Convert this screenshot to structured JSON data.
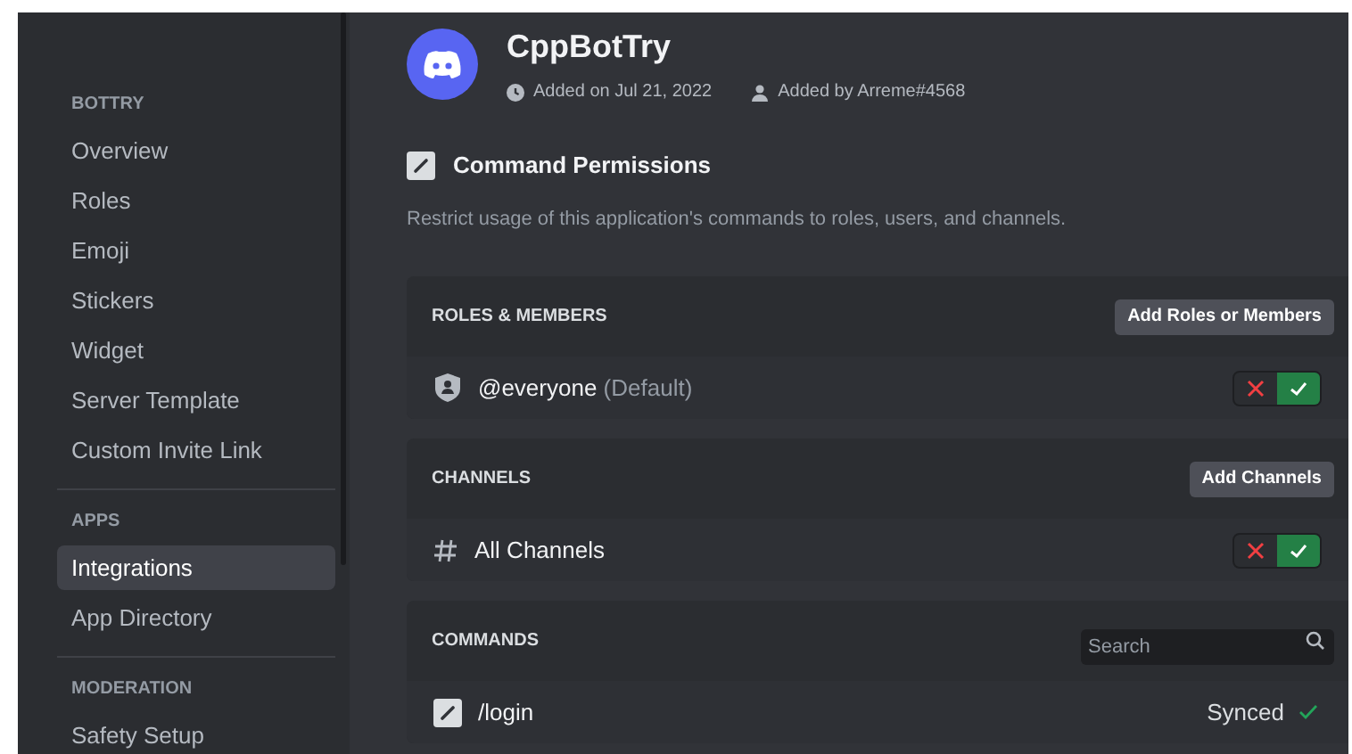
{
  "sidebar": {
    "sections": [
      {
        "header": "BOTTRY",
        "items": [
          {
            "label": "Overview",
            "selected": false
          },
          {
            "label": "Roles",
            "selected": false
          },
          {
            "label": "Emoji",
            "selected": false
          },
          {
            "label": "Stickers",
            "selected": false
          },
          {
            "label": "Widget",
            "selected": false
          },
          {
            "label": "Server Template",
            "selected": false
          },
          {
            "label": "Custom Invite Link",
            "selected": false
          }
        ]
      },
      {
        "header": "APPS",
        "items": [
          {
            "label": "Integrations",
            "selected": true
          },
          {
            "label": "App Directory",
            "selected": false
          }
        ]
      },
      {
        "header": "MODERATION",
        "items": [
          {
            "label": "Safety Setup",
            "selected": false
          }
        ]
      }
    ]
  },
  "app": {
    "name": "CppBotTry",
    "added_on": "Added on Jul 21, 2022",
    "added_by": "Added by Arreme#4568"
  },
  "permissions": {
    "title": "Command Permissions",
    "description": "Restrict usage of this application's commands to roles, users, and channels."
  },
  "sections": [
    {
      "kind": "roles",
      "title": "ROLES & MEMBERS",
      "action": "Add Roles or Members",
      "row": {
        "name": "@everyone",
        "suffix": "(Default)",
        "toggle": [
          {
            "kind": "deny",
            "selected": false
          },
          {
            "kind": "allow",
            "selected": true
          }
        ]
      }
    },
    {
      "kind": "channels",
      "title": "CHANNELS",
      "action": "Add Channels",
      "row": {
        "name": "All Channels",
        "toggle": [
          {
            "kind": "deny",
            "selected": false
          },
          {
            "kind": "allow",
            "selected": true
          }
        ]
      }
    },
    {
      "kind": "commands",
      "title": "COMMANDS",
      "search": {
        "placeholder": "Search"
      },
      "row": {
        "name": "/login",
        "status": "Synced"
      }
    }
  ]
}
